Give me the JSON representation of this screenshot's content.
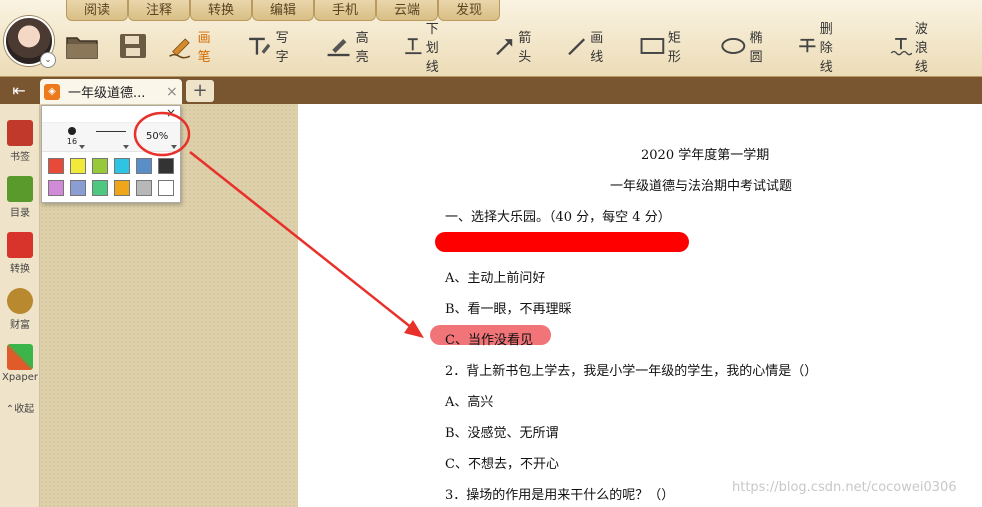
{
  "toolbar": {
    "tabs": [
      "阅读",
      "注释",
      "转换",
      "编辑",
      "手机",
      "云端",
      "发现"
    ],
    "tools": [
      {
        "icon": "folder-icon",
        "label": ""
      },
      {
        "icon": "save-icon",
        "label": ""
      },
      {
        "icon": "pen-icon",
        "label": "画笔"
      },
      {
        "icon": "text-icon",
        "label": "写字"
      },
      {
        "icon": "highlight-icon",
        "label": "高亮"
      },
      {
        "icon": "underline-icon",
        "label": "下划线"
      },
      {
        "icon": "arrow-icon",
        "label": "箭头"
      },
      {
        "icon": "line-icon",
        "label": "画线"
      },
      {
        "icon": "rectangle-icon",
        "label": "矩形"
      },
      {
        "icon": "ellipse-icon",
        "label": "椭圆"
      },
      {
        "icon": "strikethrough-icon",
        "label": "删除线"
      },
      {
        "icon": "wavy-line-icon",
        "label": "波浪线"
      }
    ]
  },
  "doc_tab": {
    "title": "一年级道德...",
    "close": "×",
    "add": "+"
  },
  "sidebar": {
    "items": [
      {
        "icon": "bookmark-icon",
        "label": "书签",
        "color": "#c0392b"
      },
      {
        "icon": "toc-icon",
        "label": "目录",
        "color": "#5a9a2c"
      },
      {
        "icon": "convert-icon",
        "label": "转换",
        "color": "#d9342b"
      },
      {
        "icon": "wealth-icon",
        "label": "财富",
        "color": "#b8892e"
      },
      {
        "icon": "xpaper-icon",
        "label": "Xpaper",
        "color": "#e05a2a"
      }
    ],
    "collapse": "收起"
  },
  "pen_popup": {
    "size": "16",
    "opacity": "50%",
    "close": "×",
    "colors": [
      "#e84a3a",
      "#f2ea3a",
      "#98c93a",
      "#2ec4e4",
      "#5a8ec6",
      "#333333",
      "#d08ad8",
      "#8a9ed4",
      "#4ec880",
      "#f0a61a",
      "#b8b8b8",
      "#ffffff"
    ]
  },
  "document": {
    "lines": [
      "2020 学年度第一学期",
      "一年级道德与法治期中考试试题",
      "一、选择大乐园。（40 分，每空 4 分）",
      "A、主动上前问好",
      "B、看一眼，不再理睬",
      "C、当作没看见",
      "2．背上新书包上学去，我是小学一年级的学生，我的心情是（）",
      "A、高兴",
      "B、没感觉、无所谓",
      "C、不想去，不开心",
      "3．操场的作用是用来干什么的呢？（）"
    ],
    "highlight_color": "#f07478",
    "redaction_color": "#ff0000"
  },
  "watermark": "https://blog.csdn.net/cocowei0306",
  "annotation_color": "#e8312a"
}
